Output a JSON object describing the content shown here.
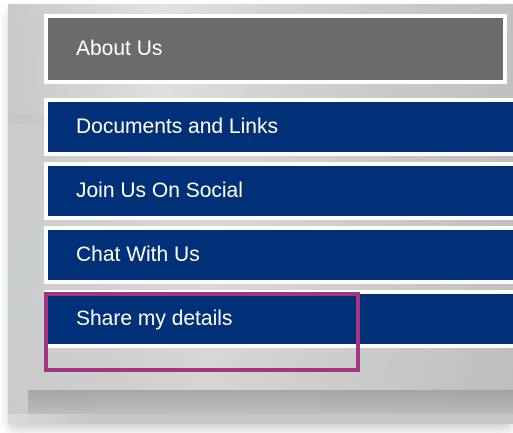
{
  "menu": {
    "items": [
      {
        "label": "About Us",
        "style": "gray"
      },
      {
        "label": "Documents and Links",
        "style": "blue"
      },
      {
        "label": "Join Us On Social",
        "style": "blue"
      },
      {
        "label": "Chat With Us",
        "style": "blue"
      },
      {
        "label": "Share my details",
        "style": "blue"
      }
    ]
  },
  "colors": {
    "gray_item": "#6b6b6b",
    "blue_item": "#003178",
    "highlight_border": "#a6347e",
    "text": "#ffffff"
  }
}
